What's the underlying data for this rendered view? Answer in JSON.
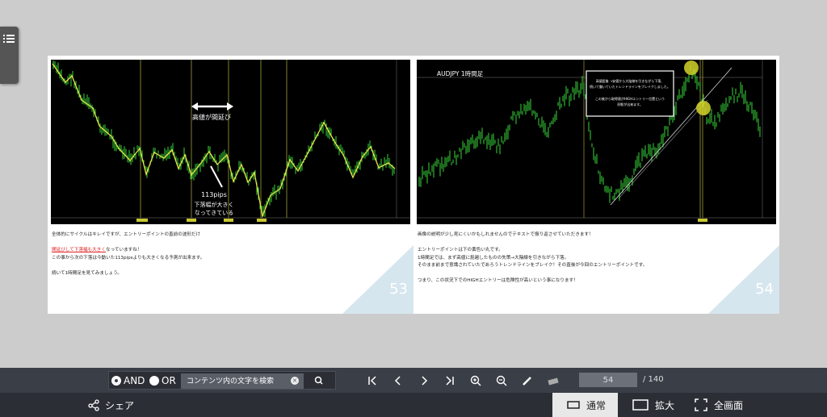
{
  "left_page": {
    "chart": {
      "annotation_top": "高値が間延び",
      "annotation_pips": "113pips",
      "annotation_bottom1": "下落幅が大きく",
      "annotation_bottom2": "なってきている"
    },
    "lines": [
      "全体的にサイクルはキレイですが、エントリーポイントの直前の波形だけ",
      "",
      "間延びしていて下落幅も大きくなっていますね！",
      "この事から次の下落は今動いた113pipsよりも大きくなる予測が出来ます。",
      "",
      "続いて1時間足を見てみましょう。"
    ],
    "red_phrases": [
      "間延びして下落幅も大きく",
      "次の下落は今動いた113pipsよりも大きくなる予測"
    ],
    "page_number": "53"
  },
  "right_page": {
    "chart": {
      "title": "AUDJPY 1時間足",
      "box_line1": "高値髭後 →安値から大陰線を引きながら下落、",
      "box_line2": "続いて働いていたトレンドラインをブレイクしました。",
      "box_line3": "この後から取得値がHIGHエントリー位置という",
      "box_line4": "形態が出来ます。"
    },
    "lines": [
      "画像の説明が少し見にくいかもしれませんのでテキストで振り返させていただきます！",
      "",
      "エントリーポイントは下の黄色い丸です。",
      "1時間足では、まず高値に髭越したものの失策→大陰線を引きながら下落。",
      "そのまま前まで意識されていたであろうトレンドラインをブレイク！その直後が今回のエントリーポイントです。",
      "",
      "つまり、この状況下でのHIGHエントリーは危険性が高いという事になります！"
    ],
    "page_number": "54"
  },
  "toolbar": {
    "and_label": "AND",
    "or_label": "OR",
    "search_placeholder": "コンテンツ内の文字を検索",
    "current_page": "54",
    "total_pages": "/ 140"
  },
  "bottom": {
    "share_label": "シェア",
    "mode_normal": "通常",
    "mode_zoom": "拡大",
    "mode_full": "全画面"
  },
  "colors": {
    "toolbar_bg": "#3a3f47",
    "bottom_bg": "#2b2f35",
    "page_corner": "#d6e6ee",
    "candle_green": "#39d63a",
    "zigzag_yellow": "#e6e64a"
  }
}
